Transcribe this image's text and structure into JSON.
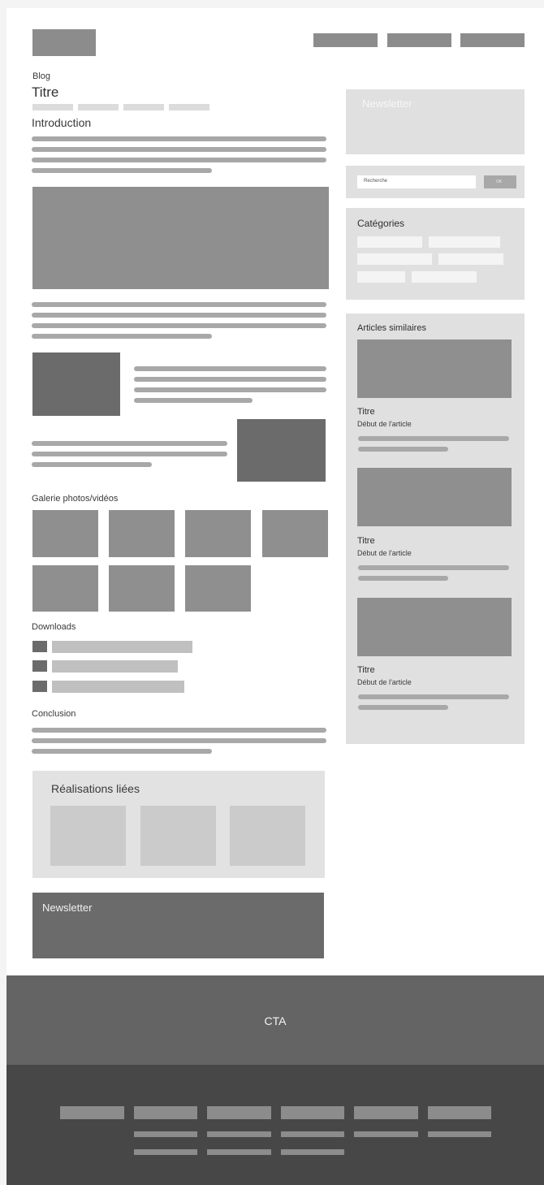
{
  "header": {
    "logo_icon": "logo-placeholder",
    "nav_items": [
      "",
      "",
      ""
    ]
  },
  "breadcrumb": "Blog",
  "page_title": "Titre",
  "sections": {
    "introduction": "Introduction",
    "gallery": "Galerie photos/vidéos",
    "downloads": "Downloads",
    "conclusion": "Conclusion",
    "related_projects": "Réalisations liées",
    "newsletter_bottom": "Newsletter"
  },
  "sidebar": {
    "newsletter": "Newsletter",
    "search": {
      "placeholder": "Recherche",
      "button": "OK"
    },
    "categories_title": "Catégories",
    "similar_title": "Articles similaires",
    "articles": [
      {
        "title": "Titre",
        "excerpt": "Début de l'article"
      },
      {
        "title": "Titre",
        "excerpt": "Début de l'article"
      },
      {
        "title": "Titre",
        "excerpt": "Début de l'article"
      }
    ]
  },
  "cta": {
    "label": "CTA"
  },
  "colors": {
    "placeholder_dark": "#6b6b6b",
    "placeholder_mid": "#8f8f8f",
    "placeholder_light": "#dcdcdc",
    "cta_band": "#646464",
    "footer_band": "#474747"
  }
}
